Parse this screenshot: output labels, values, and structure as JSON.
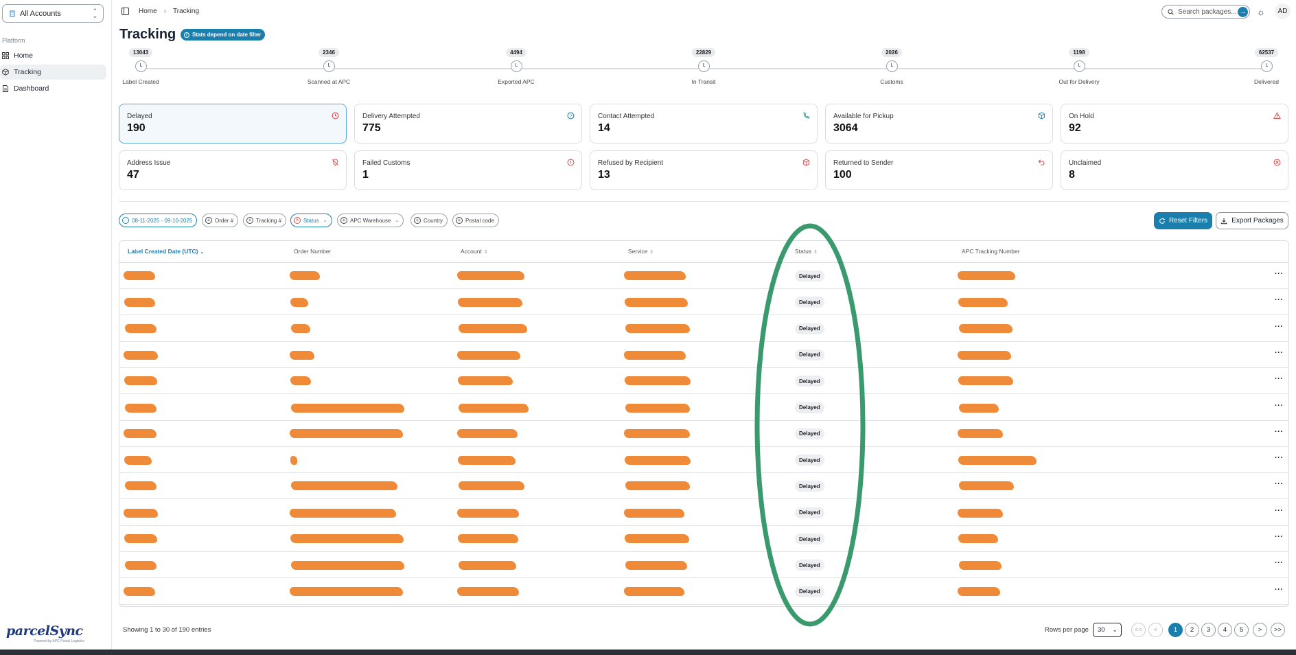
{
  "sidebar": {
    "account_label": "All Accounts",
    "section_label": "Platform",
    "items": [
      {
        "label": "Home",
        "icon": "grid-icon"
      },
      {
        "label": "Tracking",
        "icon": "package-icon",
        "active": true
      },
      {
        "label": "Dashboard",
        "icon": "document-icon"
      }
    ],
    "logo_text": "parcelSync",
    "logo_tagline": "Powered by APC Postal Logistics"
  },
  "topbar": {
    "breadcrumb": [
      "Home",
      "Tracking"
    ],
    "search_placeholder": "Search packages...",
    "avatar_initials": "AD"
  },
  "page": {
    "title": "Tracking",
    "badge": "Stats depend on date filter"
  },
  "timeline": [
    {
      "count": "13043",
      "label": "Label Created"
    },
    {
      "count": "2346",
      "label": "Scanned at APC"
    },
    {
      "count": "4494",
      "label": "Exported APC"
    },
    {
      "count": "22829",
      "label": "In Transit"
    },
    {
      "count": "2026",
      "label": "Customs"
    },
    {
      "count": "1198",
      "label": "Out for Delivery"
    },
    {
      "count": "62537",
      "label": "Delivered"
    }
  ],
  "cards": [
    {
      "label": "Delayed",
      "value": "190",
      "icon": "clock-icon",
      "color": "#d54c4c",
      "selected": true
    },
    {
      "label": "Delivery Attempted",
      "value": "775",
      "icon": "help-circle-icon",
      "color": "#1b7fae"
    },
    {
      "label": "Contact Attempted",
      "value": "14",
      "icon": "phone-icon",
      "color": "#1b9a8a"
    },
    {
      "label": "Available for Pickup",
      "value": "3064",
      "icon": "package-icon",
      "color": "#1b7fae"
    },
    {
      "label": "On Hold",
      "value": "92",
      "icon": "alert-triangle-icon",
      "color": "#d54c4c"
    },
    {
      "label": "Address Issue",
      "value": "47",
      "icon": "map-pin-off-icon",
      "color": "#d54c4c"
    },
    {
      "label": "Failed Customs",
      "value": "1",
      "icon": "alert-circle-icon",
      "color": "#d54c4c"
    },
    {
      "label": "Refused by Recipient",
      "value": "13",
      "icon": "package-x-icon",
      "color": "#d54c4c"
    },
    {
      "label": "Returned to Sender",
      "value": "100",
      "icon": "undo-icon",
      "color": "#d54c4c"
    },
    {
      "label": "Unclaimed",
      "value": "8",
      "icon": "x-circle-icon",
      "color": "#d54c4c"
    }
  ],
  "filters": [
    {
      "label": "08-11-2025 - 09-10-2025",
      "active": true
    },
    {
      "label": "Order #"
    },
    {
      "label": "Tracking #"
    },
    {
      "label": "Status",
      "active": true,
      "dropdown": true
    },
    {
      "label": "APC Warehouse",
      "dropdown": true
    },
    {
      "label": "Country"
    },
    {
      "label": "Postal code"
    }
  ],
  "actions": {
    "reset": "Reset Filters",
    "export": "Export Packages"
  },
  "table": {
    "columns": [
      "Label Created Date (UTC)",
      "Order Number",
      "Account",
      "Service",
      "Status",
      "APC Tracking Number"
    ],
    "row_status": "Delayed",
    "row_count": 13
  },
  "footer": {
    "showing": "Showing 1 to 30 of 190 entries",
    "rows_label": "Rows per page",
    "rows_value": "30",
    "pages": [
      "1",
      "2",
      "3",
      "4",
      "5"
    ],
    "first": "<<",
    "prev": "<",
    "next": ">",
    "last": ">>"
  }
}
